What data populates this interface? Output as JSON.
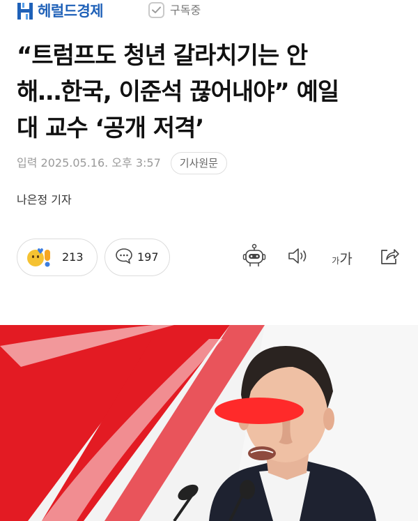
{
  "header": {
    "logo_text": "헤럴드경제",
    "logo_icon": "heraldcorp-logo-icon",
    "subscribe_label": "구독중",
    "brand_color": "#1f61b8"
  },
  "article": {
    "headline_line1": "“트럼프도 청년 갈라치기는 안",
    "headline_line2": "해…한국, 이준석 끊어내야” 예일",
    "headline_line3": "대 교수 ‘공개 저격’",
    "published": "입력 2025.05.16. 오후 3:57",
    "origin_button": "기사원문",
    "reporter": "나은정 기자"
  },
  "engagement": {
    "reactions_count": "213",
    "comments_count": "197",
    "reaction_icons": [
      "smile-emoji-icon",
      "heart-icon",
      "exclamation-icon"
    ]
  },
  "toolbar": {
    "font_small_glyph": "가",
    "font_big_glyph": "가",
    "icons": [
      "summary-bot-icon",
      "speaker-icon",
      "font-size-icon",
      "share-icon"
    ]
  },
  "photo": {
    "accent_color": "#e31b23",
    "censor_color": "#ff2a2a"
  }
}
